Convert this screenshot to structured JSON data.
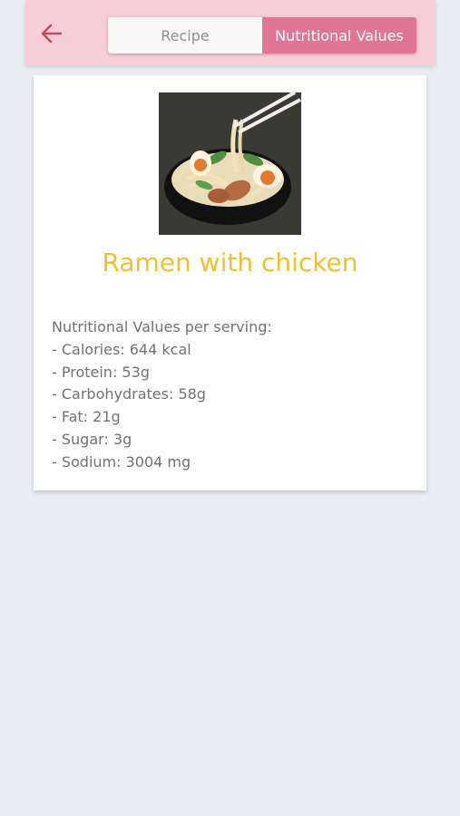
{
  "header": {
    "back_icon": "arrow-left-icon",
    "tabs": [
      {
        "label": "Recipe",
        "active": false
      },
      {
        "label": "Nutritional Values",
        "active": true
      }
    ]
  },
  "recipe": {
    "title": "Ramen with chicken",
    "image": "ramen-bowl-illustration",
    "nutrition_heading": "Nutritional Values per serving:",
    "nutrition_items": [
      "- Calories: 644 kcal",
      "- Protein: 53g",
      "- Carbohydrates: 58g",
      "- Fat: 21g",
      "- Sugar: 3g",
      "- Sodium: 3004 mg"
    ]
  },
  "colors": {
    "header_bg": "#f7cdd8",
    "active_tab": "#e07596",
    "title": "#f1c02c",
    "back_arrow": "#c9475f"
  }
}
